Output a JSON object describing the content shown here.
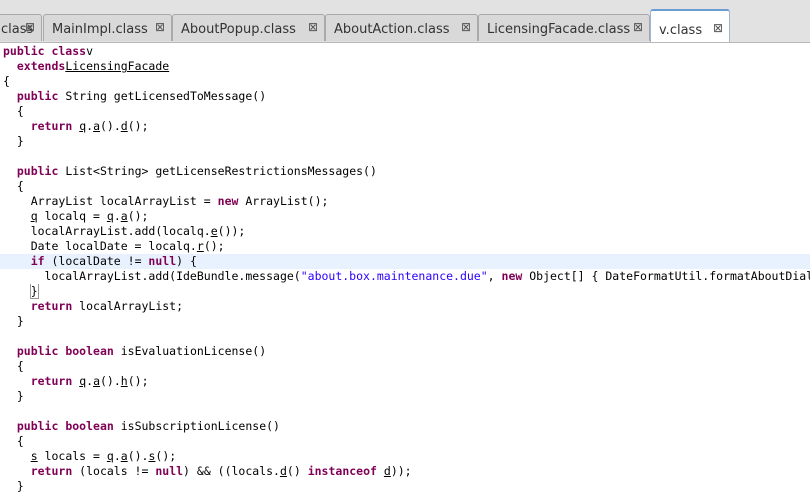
{
  "tabs": [
    {
      "label": "class",
      "close": "⊠",
      "active": false
    },
    {
      "label": "MainImpl.class",
      "close": "⊠",
      "active": false
    },
    {
      "label": "AboutPopup.class",
      "close": "⊠",
      "active": false
    },
    {
      "label": "AboutAction.class",
      "close": "⊠",
      "active": false
    },
    {
      "label": "LicensingFacade.class",
      "close": "⊠",
      "active": false
    },
    {
      "label": "v.class",
      "close": "⊠",
      "active": true
    }
  ],
  "code": [
    [
      [
        "kw",
        "public class"
      ],
      [
        "",
        "v"
      ]
    ],
    [
      [
        "",
        "  "
      ],
      [
        "kw",
        "extends"
      ],
      [
        "",
        ""
      ],
      [
        "ul",
        "LicensingFacade"
      ]
    ],
    [
      [
        "",
        "{"
      ]
    ],
    [
      [
        "",
        "  "
      ],
      [
        "kw",
        "public"
      ],
      [
        "",
        " String getLicensedToMessage()"
      ]
    ],
    [
      [
        "",
        "  {"
      ]
    ],
    [
      [
        "",
        "    "
      ],
      [
        "kw",
        "return"
      ],
      [
        "",
        " "
      ],
      [
        "ul",
        "q"
      ],
      [
        "",
        "."
      ],
      [
        "ul",
        "a"
      ],
      [
        "",
        "()."
      ],
      [
        "ul",
        "d"
      ],
      [
        "",
        "();"
      ]
    ],
    [
      [
        "",
        "  }"
      ]
    ],
    [
      [
        "",
        ""
      ]
    ],
    [
      [
        "",
        "  "
      ],
      [
        "kw",
        "public"
      ],
      [
        "",
        " List<String> getLicenseRestrictionsMessages()"
      ]
    ],
    [
      [
        "",
        "  {"
      ]
    ],
    [
      [
        "",
        "    ArrayList localArrayList = "
      ],
      [
        "kw",
        "new"
      ],
      [
        "",
        " ArrayList();"
      ]
    ],
    [
      [
        "",
        "    "
      ],
      [
        "ul",
        "q"
      ],
      [
        "",
        " localq = "
      ],
      [
        "ul",
        "q"
      ],
      [
        "",
        "."
      ],
      [
        "ul",
        "a"
      ],
      [
        "",
        "();"
      ]
    ],
    [
      [
        "",
        "    localArrayList.add(localq."
      ],
      [
        "ul",
        "e"
      ],
      [
        "",
        "());"
      ]
    ],
    [
      [
        "",
        "    Date localDate = localq."
      ],
      [
        "ul",
        "r"
      ],
      [
        "",
        "();"
      ]
    ],
    [
      [
        "",
        "    "
      ],
      [
        "kw",
        "if"
      ],
      [
        "",
        " (localDate != "
      ],
      [
        "kw",
        "null"
      ],
      [
        "",
        ") {"
      ]
    ],
    [
      [
        "",
        "      localArrayList.add(IdeBundle.message("
      ],
      [
        "str",
        "\"about.box.maintenance.due\""
      ],
      [
        "",
        ", "
      ],
      [
        "kw",
        "new"
      ],
      [
        "",
        " Object[] { DateFormatUtil.formatAboutDialogDate(localDate) }));"
      ]
    ],
    [
      [
        "",
        "    "
      ],
      [
        "box",
        "}"
      ]
    ],
    [
      [
        "",
        "    "
      ],
      [
        "kw",
        "return"
      ],
      [
        "",
        " localArrayList;"
      ]
    ],
    [
      [
        "",
        "  }"
      ]
    ],
    [
      [
        "",
        ""
      ]
    ],
    [
      [
        "",
        "  "
      ],
      [
        "kw",
        "public boolean"
      ],
      [
        "",
        " isEvaluationLicense()"
      ]
    ],
    [
      [
        "",
        "  {"
      ]
    ],
    [
      [
        "",
        "    "
      ],
      [
        "kw",
        "return"
      ],
      [
        "",
        " "
      ],
      [
        "ul",
        "q"
      ],
      [
        "",
        "."
      ],
      [
        "ul",
        "a"
      ],
      [
        "",
        "()."
      ],
      [
        "ul",
        "h"
      ],
      [
        "",
        "();"
      ]
    ],
    [
      [
        "",
        "  }"
      ]
    ],
    [
      [
        "",
        ""
      ]
    ],
    [
      [
        "",
        "  "
      ],
      [
        "kw",
        "public boolean"
      ],
      [
        "",
        " isSubscriptionLicense()"
      ]
    ],
    [
      [
        "",
        "  {"
      ]
    ],
    [
      [
        "",
        "    "
      ],
      [
        "ul",
        "s"
      ],
      [
        "",
        " locals = "
      ],
      [
        "ul",
        "q"
      ],
      [
        "",
        "."
      ],
      [
        "ul",
        "a"
      ],
      [
        "",
        "()."
      ],
      [
        "ul",
        "s"
      ],
      [
        "",
        "();"
      ]
    ],
    [
      [
        "",
        "    "
      ],
      [
        "kw",
        "return"
      ],
      [
        "",
        " (locals != "
      ],
      [
        "kw",
        "null"
      ],
      [
        "",
        ") && ((locals."
      ],
      [
        "ul",
        "d"
      ],
      [
        "",
        "() "
      ],
      [
        "kw",
        "instanceof"
      ],
      [
        "",
        " "
      ],
      [
        "ul",
        "d"
      ],
      [
        "",
        "));"
      ]
    ],
    [
      [
        "",
        "  }"
      ]
    ]
  ],
  "highlighted_line": 14
}
